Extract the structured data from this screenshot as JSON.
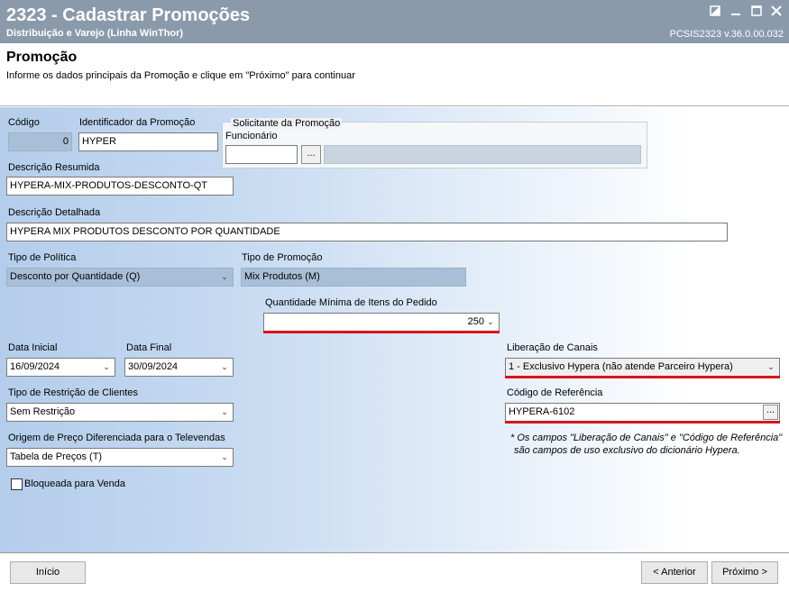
{
  "window": {
    "title": "2323 - Cadastrar Promoções",
    "subtitle": "Distribuição e Varejo (Linha WinThor)",
    "version": "PCSIS2323  v.36.0.00.032"
  },
  "header": {
    "title": "Promoção",
    "description": "Informe os dados principais da Promoção e clique em \"Próximo\" para continuar"
  },
  "form": {
    "codigo": {
      "label": "Código",
      "value": "0"
    },
    "identificador": {
      "label": "Identificador da Promoção",
      "value": "HYPER"
    },
    "solicitante": {
      "label": "Solicitante da Promoção",
      "funcionario_label": "Funcionário",
      "funcionario_value": "",
      "nome_value": "",
      "lookup_label": "..."
    },
    "descricao_resumida": {
      "label": "Descrição Resumida",
      "value": "HYPERA-MIX-PRODUTOS-DESCONTO-QT"
    },
    "descricao_detalhada": {
      "label": "Descrição Detalhada",
      "value": "HYPERA MIX PRODUTOS DESCONTO POR QUANTIDADE"
    },
    "tipo_politica": {
      "label": "Tipo de Política",
      "value": "Desconto por Quantidade (Q)"
    },
    "tipo_promocao": {
      "label": "Tipo de Promoção",
      "value": "Mix Produtos (M)"
    },
    "qtd_minima": {
      "label": "Quantidade Mínima de Itens do Pedido",
      "value": "250"
    },
    "data_inicial": {
      "label": "Data Inicial",
      "value": "16/09/2024"
    },
    "data_final": {
      "label": "Data Final",
      "value": "30/09/2024"
    },
    "liberacao_canais": {
      "label": "Liberação de Canais",
      "value": "1 - Exclusivo Hypera (não atende Parceiro Hypera)"
    },
    "tipo_restricao": {
      "label": "Tipo de Restrição de Clientes",
      "value": "Sem Restrição"
    },
    "codigo_referencia": {
      "label": "Código de Referência",
      "value": "HYPERA-6102",
      "lookup_label": "..."
    },
    "origem_preco": {
      "label": "Origem de Preço Diferenciada para o Televendas",
      "value": "Tabela de Preços (T)"
    },
    "bloqueada": {
      "label": "Bloqueada para Venda",
      "checked": false
    },
    "note_line1": "* Os campos \"Liberação de Canais\" e \"Código de Referência\"",
    "note_line2": "são campos de uso exclusivo do dicionário Hypera."
  },
  "footer": {
    "inicio": "Início",
    "anterior": "< Anterior",
    "proximo": "Próximo >"
  },
  "colors": {
    "titlebar": "#8a9aab",
    "highlight_underline": "#d9141c",
    "disabled_field": "#a9bfd8"
  },
  "icons": {
    "minimize": "minimize-icon",
    "maximize": "maximize-icon",
    "close": "close-icon",
    "restore": "restore-icon",
    "dropdown": "chevron-down-icon"
  }
}
